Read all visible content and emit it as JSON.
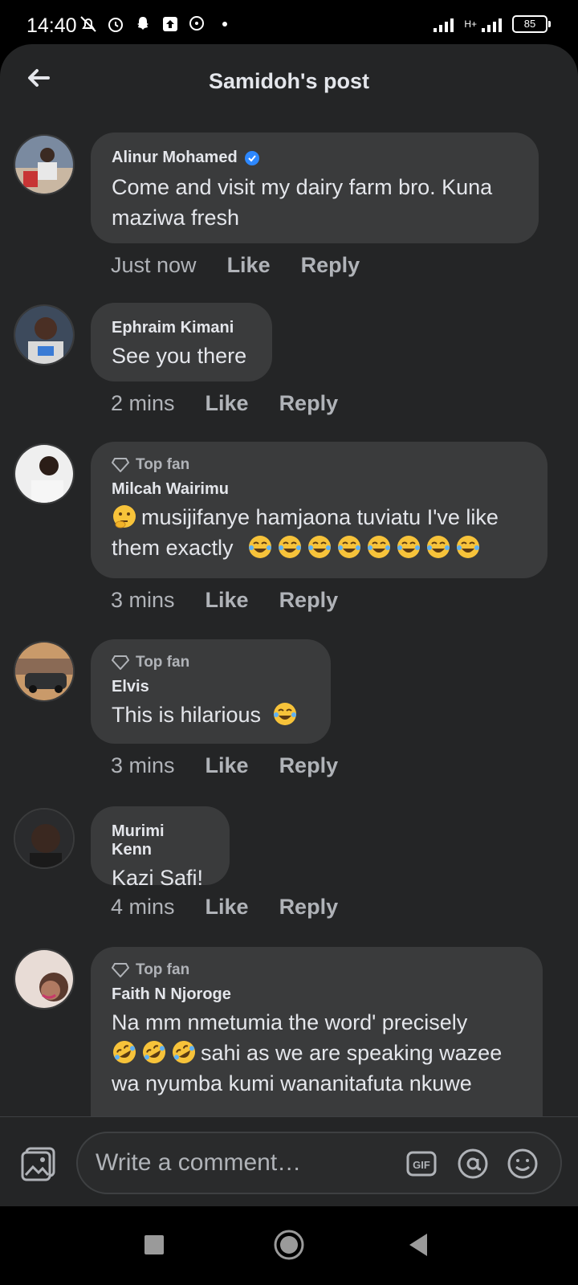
{
  "status_bar": {
    "time": "14:40",
    "network": "H+",
    "battery": "85"
  },
  "header": {
    "title": "Samidoh's post"
  },
  "comments": [
    {
      "author": "Alinur Mohamed",
      "verified": true,
      "top_fan": false,
      "text": "Come and visit my dairy farm bro. Kuna maziwa fresh",
      "time": "Just now",
      "like": "Like",
      "reply": "Reply"
    },
    {
      "author": "Ephraim Kimani",
      "top_fan": false,
      "text": "See you there",
      "time": "2 mins",
      "like": "Like",
      "reply": "Reply"
    },
    {
      "author": "Milcah Wairimu",
      "top_fan": true,
      "top_fan_label": "Top fan",
      "text_line1": "musijifanye hamjaona tuviatu I've like",
      "text_line2": "them exactly",
      "time": "3 mins",
      "like": "Like",
      "reply": "Reply"
    },
    {
      "author": "Elvis",
      "top_fan": true,
      "top_fan_label": "Top fan",
      "text": "This is hilarious",
      "time": "3 mins",
      "like": "Like",
      "reply": "Reply"
    },
    {
      "author": "Murimi Kenn",
      "top_fan": false,
      "text": "Kazi Safi!",
      "time": "4 mins",
      "like": "Like",
      "reply": "Reply"
    },
    {
      "author": "Faith N Njoroge",
      "top_fan": true,
      "top_fan_label": "Top fan",
      "text_line1": "Na mm nmetumia the word' precisely",
      "text_line2": "sahi as we are speaking wazee",
      "text_line3": "wa nyumba kumi wananitafuta nkuwe"
    }
  ],
  "composer": {
    "placeholder": "Write a comment…",
    "gif": "GIF"
  },
  "colors": {
    "background": "#242526",
    "bubble": "#3a3b3c",
    "text": "#e4e6eb",
    "muted": "#b0b3b8",
    "verified": "#2d88ff"
  },
  "icons": [
    "back-arrow-icon",
    "verified-badge-icon",
    "diamond-icon",
    "photo-icon",
    "gif-icon",
    "at-icon",
    "emoji-icon",
    "recent-apps-icon",
    "home-icon",
    "back-nav-icon"
  ]
}
